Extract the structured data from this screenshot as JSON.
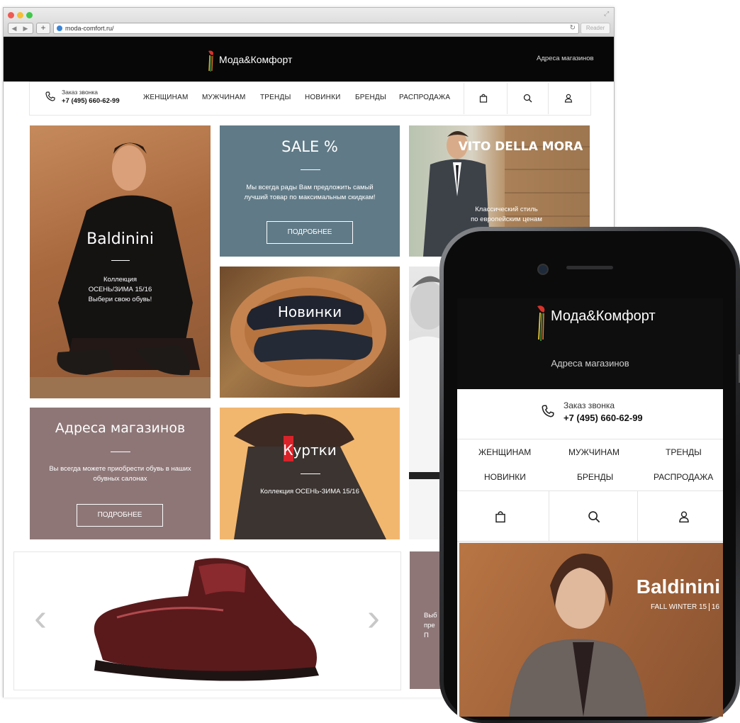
{
  "browser": {
    "url": "moda-comfort.ru/",
    "reader_label": "Reader",
    "nav_back": "◀",
    "nav_fwd": "▶",
    "new_tab": "+"
  },
  "site": {
    "logo_text": "Мода&Комфорт",
    "stores_link": "Адреса магазинов",
    "callback_label": "Заказ звонка",
    "phone": "+7 (495) 660-62-99",
    "nav": [
      "ЖЕНЩИНАМ",
      "МУЖЧИНАМ",
      "ТРЕНДЫ",
      "НОВИНКИ",
      "БРЕНДЫ",
      "РАСПРОДАЖА"
    ],
    "icons": [
      "bag-icon",
      "search-icon",
      "user-icon"
    ]
  },
  "tiles": {
    "baldinini": {
      "title": "Baldinini",
      "text": "Коллекция\nОСЕНЬ/ЗИМА 15/16\nВыбери свою обувь!"
    },
    "sale": {
      "title": "SALE %",
      "text": "Мы всегда рады Вам предложить самый лучший товар по максимальным скидкам!",
      "button": "ПОДРОБНЕЕ"
    },
    "vito": {
      "title": "VITO DELLA MORA",
      "text": "Классический стиль\nпо европейским ценам"
    },
    "novinki": {
      "title": "Новинки"
    },
    "stores": {
      "title": "Адреса магазинов",
      "text": "Вы всегда можете приобрести обувь в наших обувных салонах",
      "button": "ПОДРОБНЕЕ"
    },
    "jackets": {
      "title": "Куртки",
      "text": "Коллекция ОСЕНЬ-ЗИМА 15/16"
    },
    "partial_tile": {
      "text": "Выб\nпре\nП"
    }
  },
  "carousel": {
    "prev": "‹",
    "next": "›"
  },
  "mobile": {
    "logo_text": "Мода&Комфорт",
    "stores_link": "Адреса магазинов",
    "callback_label": "Заказ звонка",
    "phone": "+7 (495) 660-62-99",
    "nav": [
      "ЖЕНЩИНАМ",
      "МУЖЧИНАМ",
      "ТРЕНДЫ",
      "НОВИНКИ",
      "БРЕНДЫ",
      "РАСПРОДАЖА"
    ],
    "hero_title": "Baldinini",
    "hero_sub1": "FALL WINTER 15",
    "hero_sub2": "16"
  },
  "colors": {
    "header_bg": "#070707",
    "sale_bg": "#607a87",
    "stores_bg": "#8e7677",
    "jacket_bg": "#f2b76e"
  }
}
